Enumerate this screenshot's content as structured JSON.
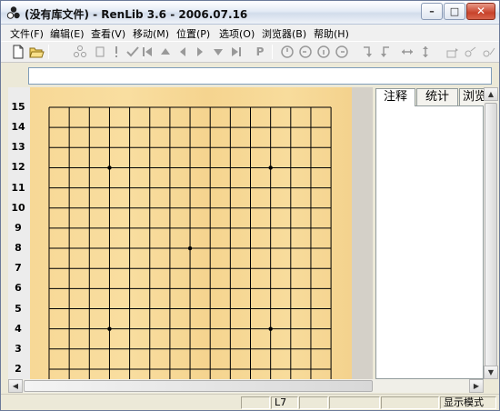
{
  "window": {
    "title": "(没有库文件) - RenLib 3.6 - 2006.07.16",
    "minimize_glyph": "–",
    "maximize_glyph": "□",
    "close_glyph": "✕"
  },
  "menu": {
    "items": [
      {
        "label": "文件(F)"
      },
      {
        "label": "编辑(E)"
      },
      {
        "label": "查看(V)"
      },
      {
        "label": "移动(M)"
      },
      {
        "label": "位置(P)"
      },
      {
        "label": "选项(O)"
      },
      {
        "label": "浏览器(B)"
      },
      {
        "label": "帮助(H)"
      }
    ]
  },
  "toolbar": {
    "buttons": [
      {
        "icon": "new-file-icon"
      },
      {
        "icon": "open-folder-icon"
      },
      {
        "icon": "branch-icon"
      },
      {
        "icon": "mark-icon"
      },
      {
        "icon": "exclaim-icon"
      },
      {
        "icon": "check-icon"
      },
      {
        "icon": "first-move-icon"
      },
      {
        "icon": "up-icon"
      },
      {
        "icon": "back-icon"
      },
      {
        "icon": "forward-icon"
      },
      {
        "icon": "down-icon"
      },
      {
        "icon": "last-move-icon"
      },
      {
        "icon": "pass-icon",
        "label": "P"
      },
      {
        "icon": "clock-icon"
      },
      {
        "icon": "rotate-left-icon"
      },
      {
        "icon": "rotate-info-icon"
      },
      {
        "icon": "rotate-right-icon"
      },
      {
        "icon": "flip-down-icon"
      },
      {
        "icon": "flip-up-icon"
      },
      {
        "icon": "mirror-horizontal-icon"
      },
      {
        "icon": "mirror-vertical-icon"
      },
      {
        "icon": "library-icon"
      },
      {
        "icon": "library-search-icon"
      },
      {
        "icon": "library-settings-icon"
      }
    ]
  },
  "comment_field": {
    "value": ""
  },
  "board": {
    "row_labels": [
      "15",
      "14",
      "13",
      "12",
      "11",
      "10",
      "9",
      "8",
      "7",
      "6",
      "5",
      "4",
      "3",
      "2"
    ],
    "visible_rows": 14,
    "size": 15,
    "colors": {
      "wood": "#f8da99",
      "line": "#000000"
    }
  },
  "panel": {
    "tabs": [
      {
        "label": "注释",
        "active": true
      },
      {
        "label": "统计",
        "active": false
      },
      {
        "label": "浏览",
        "active": false
      }
    ]
  },
  "scroll": {
    "up_glyph": "▲",
    "down_glyph": "▼",
    "left_glyph": "◀",
    "right_glyph": "▶"
  },
  "status": {
    "cells": [
      "",
      "L7",
      "",
      "",
      "",
      "显示模式"
    ]
  }
}
